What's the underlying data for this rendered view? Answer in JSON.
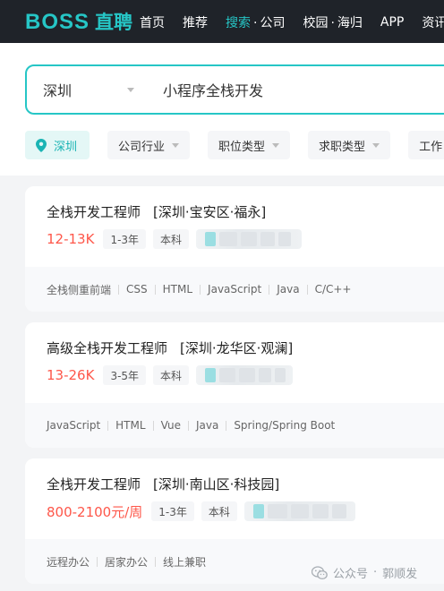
{
  "nav": {
    "logo_boss": "BOSS",
    "logo_zp": "直聘",
    "items": [
      {
        "label": "首页"
      },
      {
        "label": "推荐"
      },
      {
        "label": "搜索",
        "sub": "公司"
      },
      {
        "label": "校园",
        "sub": "海归"
      },
      {
        "label": "APP"
      },
      {
        "label": "资讯"
      }
    ],
    "active_index": 2,
    "accent_color": "#26c6c6"
  },
  "search": {
    "city": "深圳",
    "query": "小程序全栈开发"
  },
  "filters": [
    {
      "label": "深圳",
      "icon": "location-pin-icon"
    },
    {
      "label": "公司行业"
    },
    {
      "label": "职位类型"
    },
    {
      "label": "求职类型"
    },
    {
      "label": "工作"
    }
  ],
  "jobs": [
    {
      "title": "全栈开发工程师",
      "area": "[深圳·宝安区·福永]",
      "salary": "12-13K",
      "tags": [
        "1-3年",
        "本科"
      ],
      "skills": [
        "全栈侧重前端",
        "CSS",
        "HTML",
        "JavaScript",
        "Java",
        "C/C++"
      ]
    },
    {
      "title": "高级全栈开发工程师",
      "area": "[深圳·龙华区·观澜]",
      "salary": "13-26K",
      "tags": [
        "3-5年",
        "本科"
      ],
      "skills": [
        "JavaScript",
        "HTML",
        "Vue",
        "Java",
        "Spring/Spring Boot"
      ]
    },
    {
      "title": "全栈开发工程师",
      "area": "[深圳·南山区·科技园]",
      "salary": "800-2100元/周",
      "tags": [
        "1-3年",
        "本科"
      ],
      "skills": [
        "远程办公",
        "居家办公",
        "线上兼职"
      ]
    }
  ],
  "watermark": {
    "prefix": "公众号",
    "name": "郭顺发"
  }
}
